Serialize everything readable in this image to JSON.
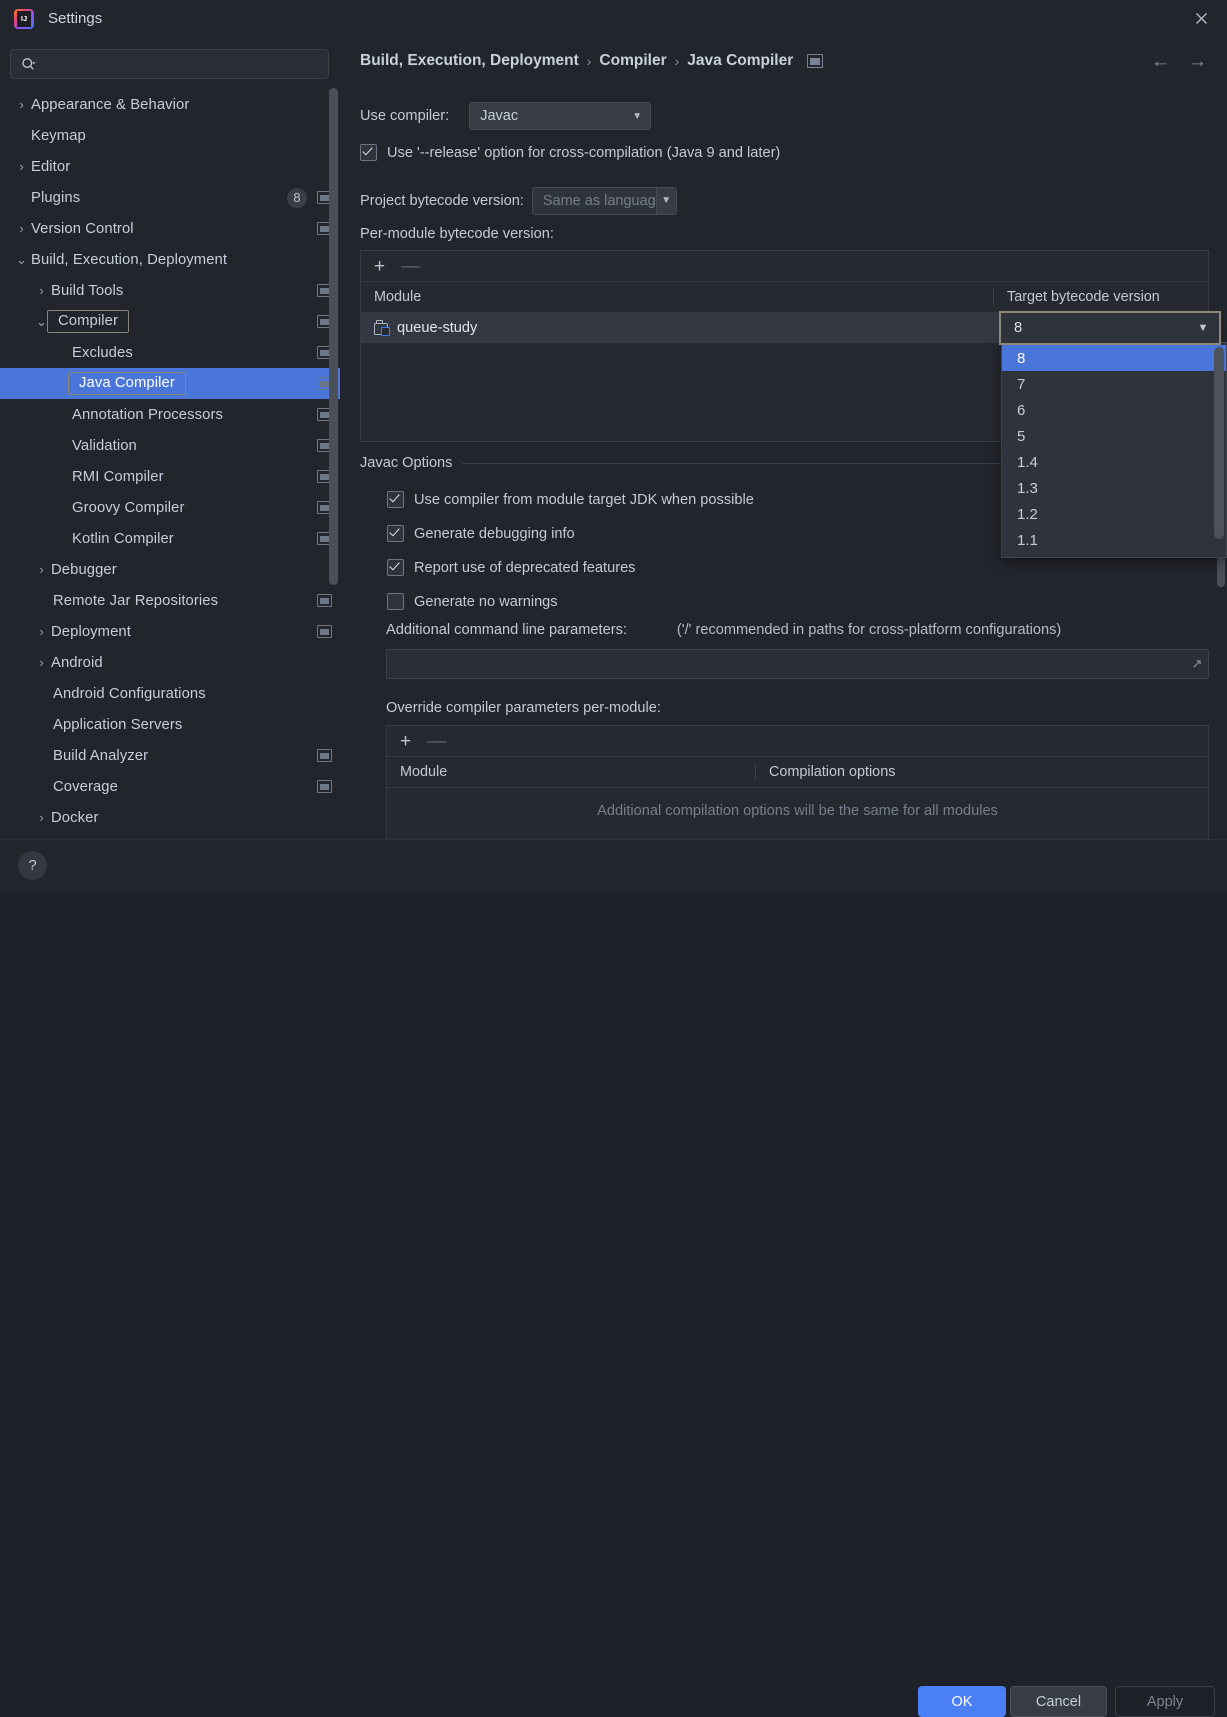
{
  "window": {
    "title": "Settings",
    "logo_icon": "intellij-idea-logo",
    "close_icon": "close-icon"
  },
  "search": {
    "placeholder": "",
    "value": "",
    "icon": "search-icon"
  },
  "sidebar": {
    "items": [
      {
        "label": "Appearance & Behavior",
        "arrow": "›",
        "indent": "ind0",
        "ext_icon": false,
        "badge": null,
        "selected": false,
        "boxed": false
      },
      {
        "label": "Keymap",
        "arrow": "",
        "indent": "ind0-noarrow",
        "ext_icon": false,
        "badge": null,
        "selected": false,
        "boxed": false
      },
      {
        "label": "Editor",
        "arrow": "›",
        "indent": "ind0",
        "ext_icon": false,
        "badge": null,
        "selected": false,
        "boxed": false
      },
      {
        "label": "Plugins",
        "arrow": "",
        "indent": "ind0-noarrow",
        "ext_icon": true,
        "badge": "8",
        "selected": false,
        "boxed": false
      },
      {
        "label": "Version Control",
        "arrow": "›",
        "indent": "ind0",
        "ext_icon": true,
        "badge": null,
        "selected": false,
        "boxed": false
      },
      {
        "label": "Build, Execution, Deployment",
        "arrow": "⌄",
        "indent": "ind0",
        "ext_icon": false,
        "badge": null,
        "selected": false,
        "boxed": false
      },
      {
        "label": "Build Tools",
        "arrow": "›",
        "indent": "ind1",
        "ext_icon": true,
        "badge": null,
        "selected": false,
        "boxed": false
      },
      {
        "label": "Compiler",
        "arrow": "⌄",
        "indent": "ind1",
        "ext_icon": true,
        "badge": null,
        "selected": false,
        "boxed": true
      },
      {
        "label": "Excludes",
        "arrow": "",
        "indent": "ind2-noarrow",
        "ext_icon": true,
        "badge": null,
        "selected": false,
        "boxed": false
      },
      {
        "label": "Java Compiler",
        "arrow": "",
        "indent": "ind2-noarrow",
        "ext_icon": true,
        "badge": null,
        "selected": true,
        "boxed": true
      },
      {
        "label": "Annotation Processors",
        "arrow": "",
        "indent": "ind2-noarrow",
        "ext_icon": true,
        "badge": null,
        "selected": false,
        "boxed": false
      },
      {
        "label": "Validation",
        "arrow": "",
        "indent": "ind2-noarrow",
        "ext_icon": true,
        "badge": null,
        "selected": false,
        "boxed": false
      },
      {
        "label": "RMI Compiler",
        "arrow": "",
        "indent": "ind2-noarrow",
        "ext_icon": true,
        "badge": null,
        "selected": false,
        "boxed": false
      },
      {
        "label": "Groovy Compiler",
        "arrow": "",
        "indent": "ind2-noarrow",
        "ext_icon": true,
        "badge": null,
        "selected": false,
        "boxed": false
      },
      {
        "label": "Kotlin Compiler",
        "arrow": "",
        "indent": "ind2-noarrow",
        "ext_icon": true,
        "badge": null,
        "selected": false,
        "boxed": false
      },
      {
        "label": "Debugger",
        "arrow": "›",
        "indent": "ind1",
        "ext_icon": false,
        "badge": null,
        "selected": false,
        "boxed": false
      },
      {
        "label": "Remote Jar Repositories",
        "arrow": "",
        "indent": "ind1-noarrow",
        "ext_icon": true,
        "badge": null,
        "selected": false,
        "boxed": false
      },
      {
        "label": "Deployment",
        "arrow": "›",
        "indent": "ind1",
        "ext_icon": true,
        "badge": null,
        "selected": false,
        "boxed": false
      },
      {
        "label": "Android",
        "arrow": "›",
        "indent": "ind1",
        "ext_icon": false,
        "badge": null,
        "selected": false,
        "boxed": false
      },
      {
        "label": "Android Configurations",
        "arrow": "",
        "indent": "ind1-noarrow",
        "ext_icon": false,
        "badge": null,
        "selected": false,
        "boxed": false
      },
      {
        "label": "Application Servers",
        "arrow": "",
        "indent": "ind1-noarrow",
        "ext_icon": false,
        "badge": null,
        "selected": false,
        "boxed": false
      },
      {
        "label": "Build Analyzer",
        "arrow": "",
        "indent": "ind1-noarrow",
        "ext_icon": true,
        "badge": null,
        "selected": false,
        "boxed": false
      },
      {
        "label": "Coverage",
        "arrow": "",
        "indent": "ind1-noarrow",
        "ext_icon": true,
        "badge": null,
        "selected": false,
        "boxed": false
      },
      {
        "label": "Docker",
        "arrow": "›",
        "indent": "ind1",
        "ext_icon": false,
        "badge": null,
        "selected": false,
        "boxed": false
      }
    ]
  },
  "breadcrumb": {
    "crumb1": "Build, Execution, Deployment",
    "sep1": "›",
    "crumb2": "Compiler",
    "sep2": "›",
    "crumb3": "Java Compiler",
    "trailing_icon": "window-icon",
    "back_icon": "←",
    "forward_icon": "→"
  },
  "main": {
    "use_compiler_label": "Use compiler:",
    "use_compiler_value": "Javac",
    "release_option_label": "Use '--release' option for cross-compilation (Java 9 and later)",
    "release_option_checked": true,
    "project_bytecode_label": "Project bytecode version:",
    "project_bytecode_value": "Same as language leve",
    "per_module_label": "Per-module bytecode version:",
    "per_module_table": {
      "add_icon": "+",
      "remove_icon": "—",
      "columns": [
        "Module",
        "Target bytecode version"
      ],
      "rows": [
        {
          "module": "queue-study",
          "target": "8"
        }
      ]
    },
    "bytecode_dropdown": {
      "selected": "8",
      "options": [
        "8",
        "7",
        "6",
        "5",
        "1.4",
        "1.3",
        "1.2",
        "1.1"
      ],
      "caret_icon": "chevron-down-icon"
    },
    "javac_options_title": "Javac Options",
    "javac_options": [
      {
        "label": "Use compiler from module target JDK when possible",
        "checked": true
      },
      {
        "label": "Generate debugging info",
        "checked": true
      },
      {
        "label": "Report use of deprecated features",
        "checked": true
      },
      {
        "label": "Generate no warnings",
        "checked": false
      }
    ],
    "additional_params_label": "Additional command line parameters:",
    "additional_params_hint": "('/' recommended in paths for cross-platform configurations)",
    "additional_params_value": "",
    "override_label": "Override compiler parameters per-module:",
    "override_table": {
      "add_icon": "+",
      "remove_icon": "—",
      "columns": [
        "Module",
        "Compilation options"
      ],
      "empty_message": "Additional compilation options will be the same for all modules"
    }
  },
  "footer": {
    "help_label": "?",
    "ok_label": "OK",
    "cancel_label": "Cancel",
    "apply_label": "Apply"
  },
  "colors": {
    "accent_blue": "#4a7ff5",
    "selection_blue": "#4a76da",
    "panel_bg": "#22252c",
    "module_icon_blue": "#3d7ff0"
  }
}
